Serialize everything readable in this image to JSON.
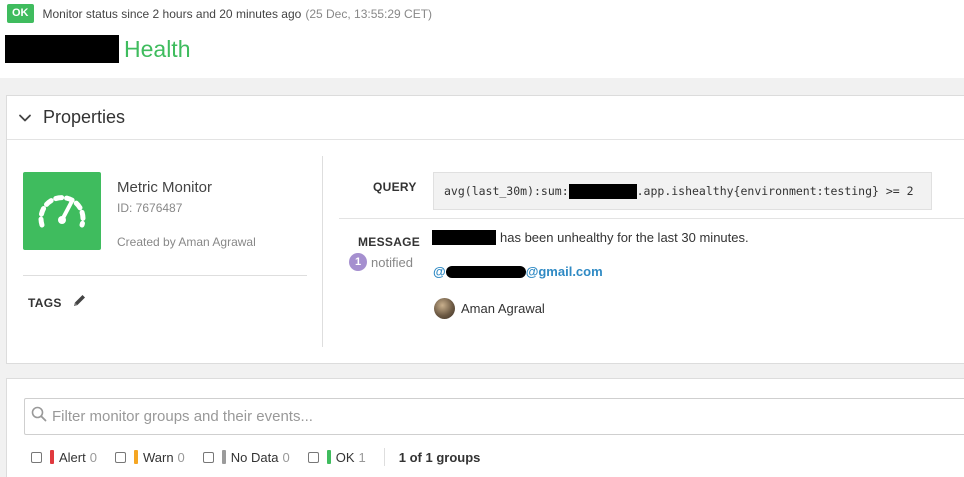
{
  "status": {
    "badge": "OK",
    "text": "Monitor status since 2 hours and 20 minutes ago",
    "time": "(25 Dec, 13:55:29 CET)",
    "color": "#3fbc5e"
  },
  "title": {
    "text": "Health"
  },
  "properties": {
    "header": "Properties",
    "monitor_type": "Metric Monitor",
    "monitor_id": "ID: 7676487",
    "created_by": "Created by Aman Agrawal",
    "tags_label": "TAGS",
    "query_label": "QUERY",
    "query_prefix": "avg(last_30m):sum:",
    "query_suffix": ".app.ishealthy{environment:testing} >= 2",
    "message_label": "MESSAGE",
    "notified_count": "1",
    "notified_label": "notified",
    "message_text": "has been unhealthy for the last 30 minutes.",
    "email_prefix": "@",
    "email_suffix": "@gmail.com",
    "user_name": "Aman Agrawal"
  },
  "filter": {
    "placeholder": "Filter monitor groups and their events...",
    "items": [
      {
        "label": "Alert",
        "count": "0",
        "color": "#e0393e"
      },
      {
        "label": "Warn",
        "count": "0",
        "color": "#f5a623"
      },
      {
        "label": "No Data",
        "count": "0",
        "color": "#9b9b9b"
      },
      {
        "label": "OK",
        "count": "1",
        "color": "#3fbc5e"
      }
    ],
    "groups_text": "1 of 1 groups"
  }
}
